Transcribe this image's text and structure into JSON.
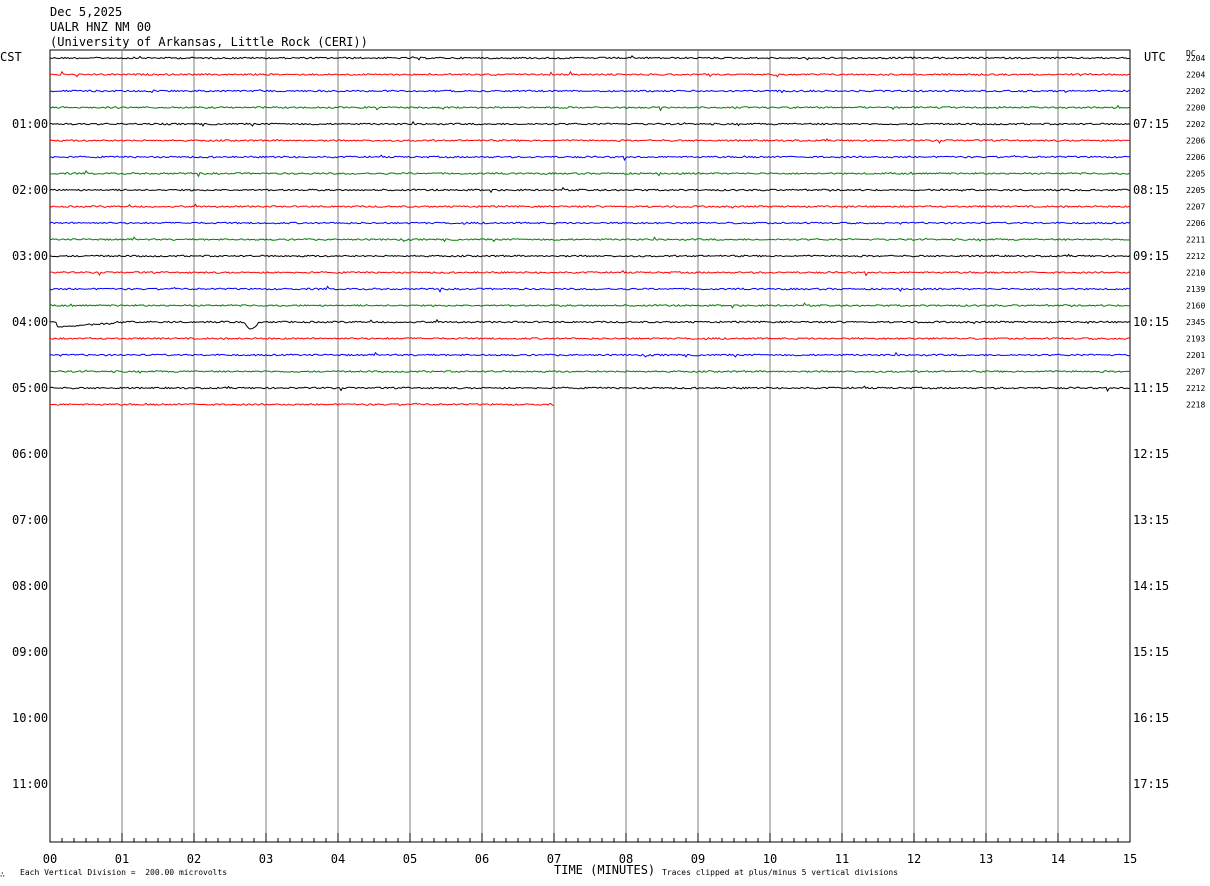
{
  "header": {
    "date": "Dec 5,2025",
    "station": "UALR HNZ NM 00",
    "institution": "(University of Arkansas, Little Rock (CERI))"
  },
  "axes": {
    "left_unit": "CST",
    "right_unit": "UTC",
    "dc_header": "DC",
    "xlabel": "TIME (MINUTES)"
  },
  "footer": {
    "scale_note": "Each Vertical Division =  200.00 microvolts",
    "clip_note": "Traces clipped at plus/minus 5 vertical divisions"
  },
  "chart_data": {
    "type": "line",
    "title": "UALR HNZ NM 00",
    "xlabel": "TIME (MINUTES)",
    "xlim": [
      0,
      15
    ],
    "x_ticks": [
      "00",
      "01",
      "02",
      "03",
      "04",
      "05",
      "06",
      "07",
      "08",
      "09",
      "10",
      "11",
      "12",
      "13",
      "14",
      "15"
    ],
    "trace_interval_minutes": 15,
    "trace_colors": [
      "#000000",
      "#ff0000",
      "#0000ff",
      "#008000"
    ],
    "left_hour_labels": [
      "01:00",
      "02:00",
      "03:00",
      "04:00",
      "05:00",
      "06:00",
      "07:00",
      "08:00",
      "09:00",
      "10:00",
      "11:00"
    ],
    "right_hour_labels": [
      "07:15",
      "08:15",
      "09:15",
      "10:15",
      "11:15",
      "12:15",
      "13:15",
      "14:15",
      "15:15",
      "16:15",
      "17:15"
    ],
    "dc_offsets": [
      "2204",
      "2204",
      "2202",
      "2200",
      "2202",
      "2206",
      "2206",
      "2205",
      "2205",
      "2207",
      "2206",
      "2211",
      "2212",
      "2210",
      "2139",
      "2160",
      "2345",
      "2193",
      "2201",
      "2207",
      "2212",
      "2218"
    ],
    "last_trace_end_minute": 7.0
  }
}
